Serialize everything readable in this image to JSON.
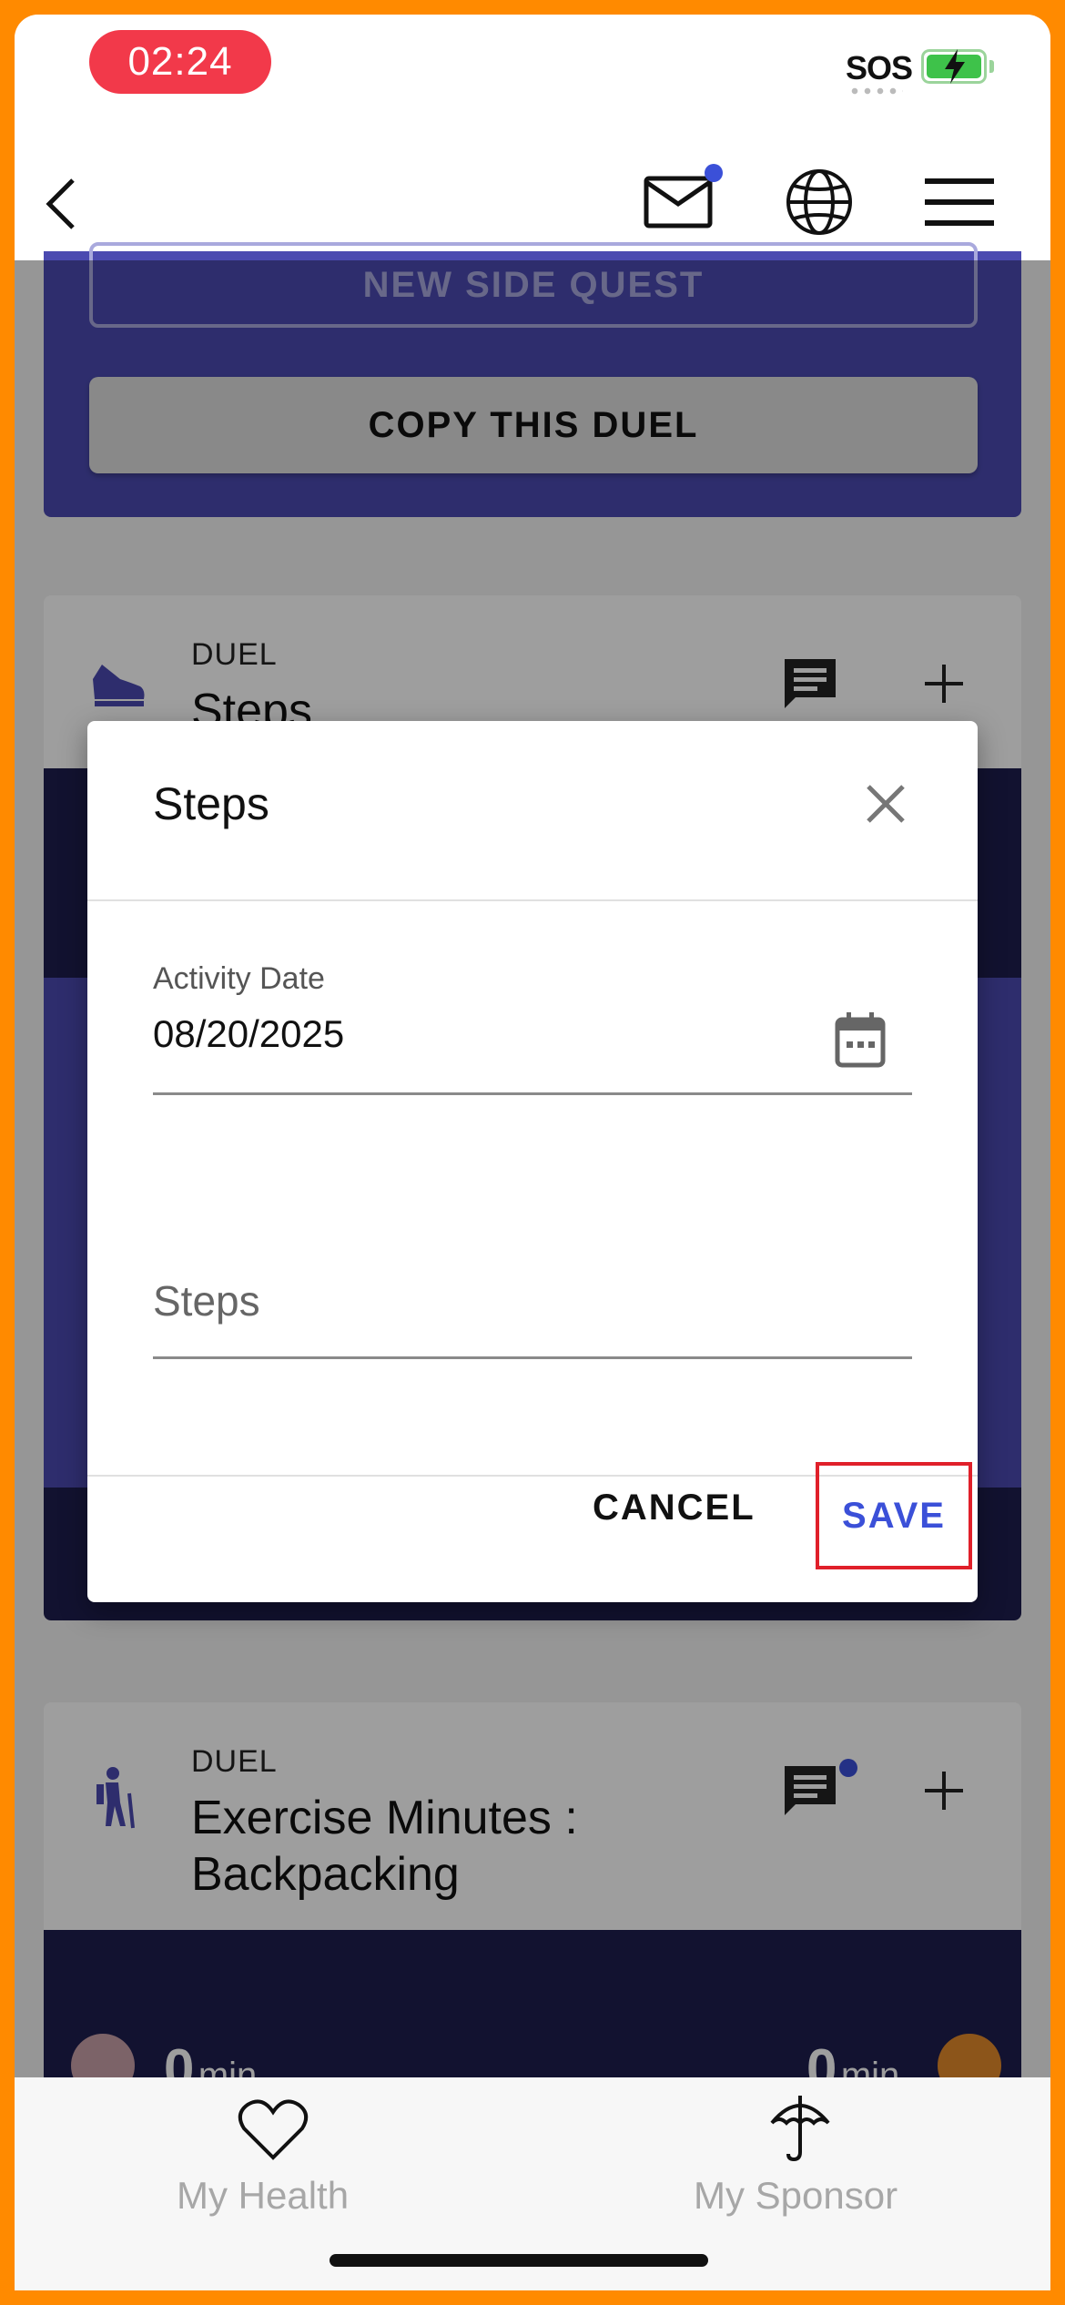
{
  "status_bar": {
    "time": "02:24",
    "carrier_text": "SOS"
  },
  "colors": {
    "accent_blue": "#3b50d8",
    "brand_purple": "#4b4ab0",
    "time_pill_red": "#f2394a",
    "frame_orange": "#ff8a00",
    "save_highlight": "#e0202a"
  },
  "top_nav": {
    "back_icon": "chevron-left-icon",
    "mail_icon": "mail-icon",
    "globe_icon": "globe-icon",
    "menu_icon": "hamburger-menu-icon"
  },
  "background": {
    "new_side_quest_label": "NEW SIDE QUEST",
    "copy_duel_label": "COPY THIS DUEL",
    "duel_1": {
      "kind": "DUEL",
      "title": "Steps"
    },
    "duel_2": {
      "kind": "DUEL",
      "title": "Exercise Minutes : Backpacking",
      "left_value": "0",
      "left_unit": "min",
      "right_value": "0",
      "right_unit": "min"
    }
  },
  "dialog": {
    "title": "Steps",
    "activity_date_label": "Activity Date",
    "activity_date_value": "08/20/2025",
    "steps_placeholder": "Steps",
    "cancel_label": "CANCEL",
    "save_label": "SAVE"
  },
  "bottom_nav": {
    "tabs": [
      {
        "label": "My Health",
        "icon": "heart-icon"
      },
      {
        "label": "My Sponsor",
        "icon": "umbrella-icon"
      }
    ]
  }
}
